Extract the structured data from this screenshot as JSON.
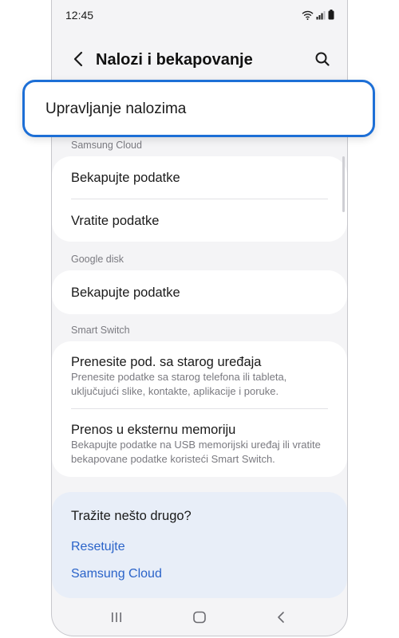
{
  "status_bar": {
    "time": "12:45"
  },
  "header": {
    "title": "Nalozi i bekapovanje"
  },
  "highlight": {
    "label": "Upravljanje nalozima"
  },
  "sections": {
    "samsung_cloud": {
      "label": "Samsung Cloud",
      "items": [
        "Bekapujte podatke",
        "Vratite podatke"
      ]
    },
    "google_disk": {
      "label": "Google disk",
      "items": [
        "Bekapujte podatke"
      ]
    },
    "smart_switch": {
      "label": "Smart Switch",
      "items": [
        {
          "title": "Prenesite pod. sa starog uređaja",
          "subtitle": "Prenesite podatke sa starog telefona ili tableta, uključujući slike, kontakte, aplikacije i poruke."
        },
        {
          "title": "Prenos u eksternu memoriju",
          "subtitle": "Bekapujte podatke na USB memorijski uređaj ili vratite bekapovane podatke koristeći Smart Switch."
        }
      ]
    }
  },
  "help": {
    "title": "Tražite nešto drugo?",
    "links": [
      "Resetujte",
      "Samsung Cloud"
    ]
  },
  "colors": {
    "highlight_border": "#1d6fd6",
    "link": "#2a63c9",
    "background": "#f4f4f6",
    "help_card": "#e8eef8"
  },
  "icons": {
    "status": [
      "wifi-icon",
      "signal-icon",
      "battery-icon"
    ],
    "header": [
      "back-arrow-icon",
      "search-icon"
    ],
    "nav": [
      "recent-apps-icon",
      "home-icon",
      "back-icon"
    ]
  }
}
